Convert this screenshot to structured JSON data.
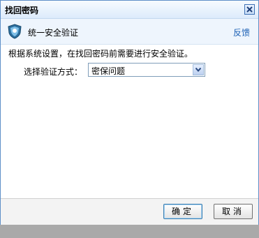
{
  "window": {
    "title": "找回密码",
    "close_icon": "close-icon"
  },
  "header": {
    "icon": "shield-icon",
    "title": "统一安全验证",
    "feedback_label": "反馈"
  },
  "main": {
    "info_text": "根据系统设置，在找回密码前需要进行安全验证。",
    "method_label": "选择验证方式：",
    "method_selected": "密保问题"
  },
  "footer": {
    "ok_label": "确定",
    "cancel_label": "取消"
  },
  "colors": {
    "accent": "#1a5fb4",
    "border": "#5e8fc8"
  }
}
